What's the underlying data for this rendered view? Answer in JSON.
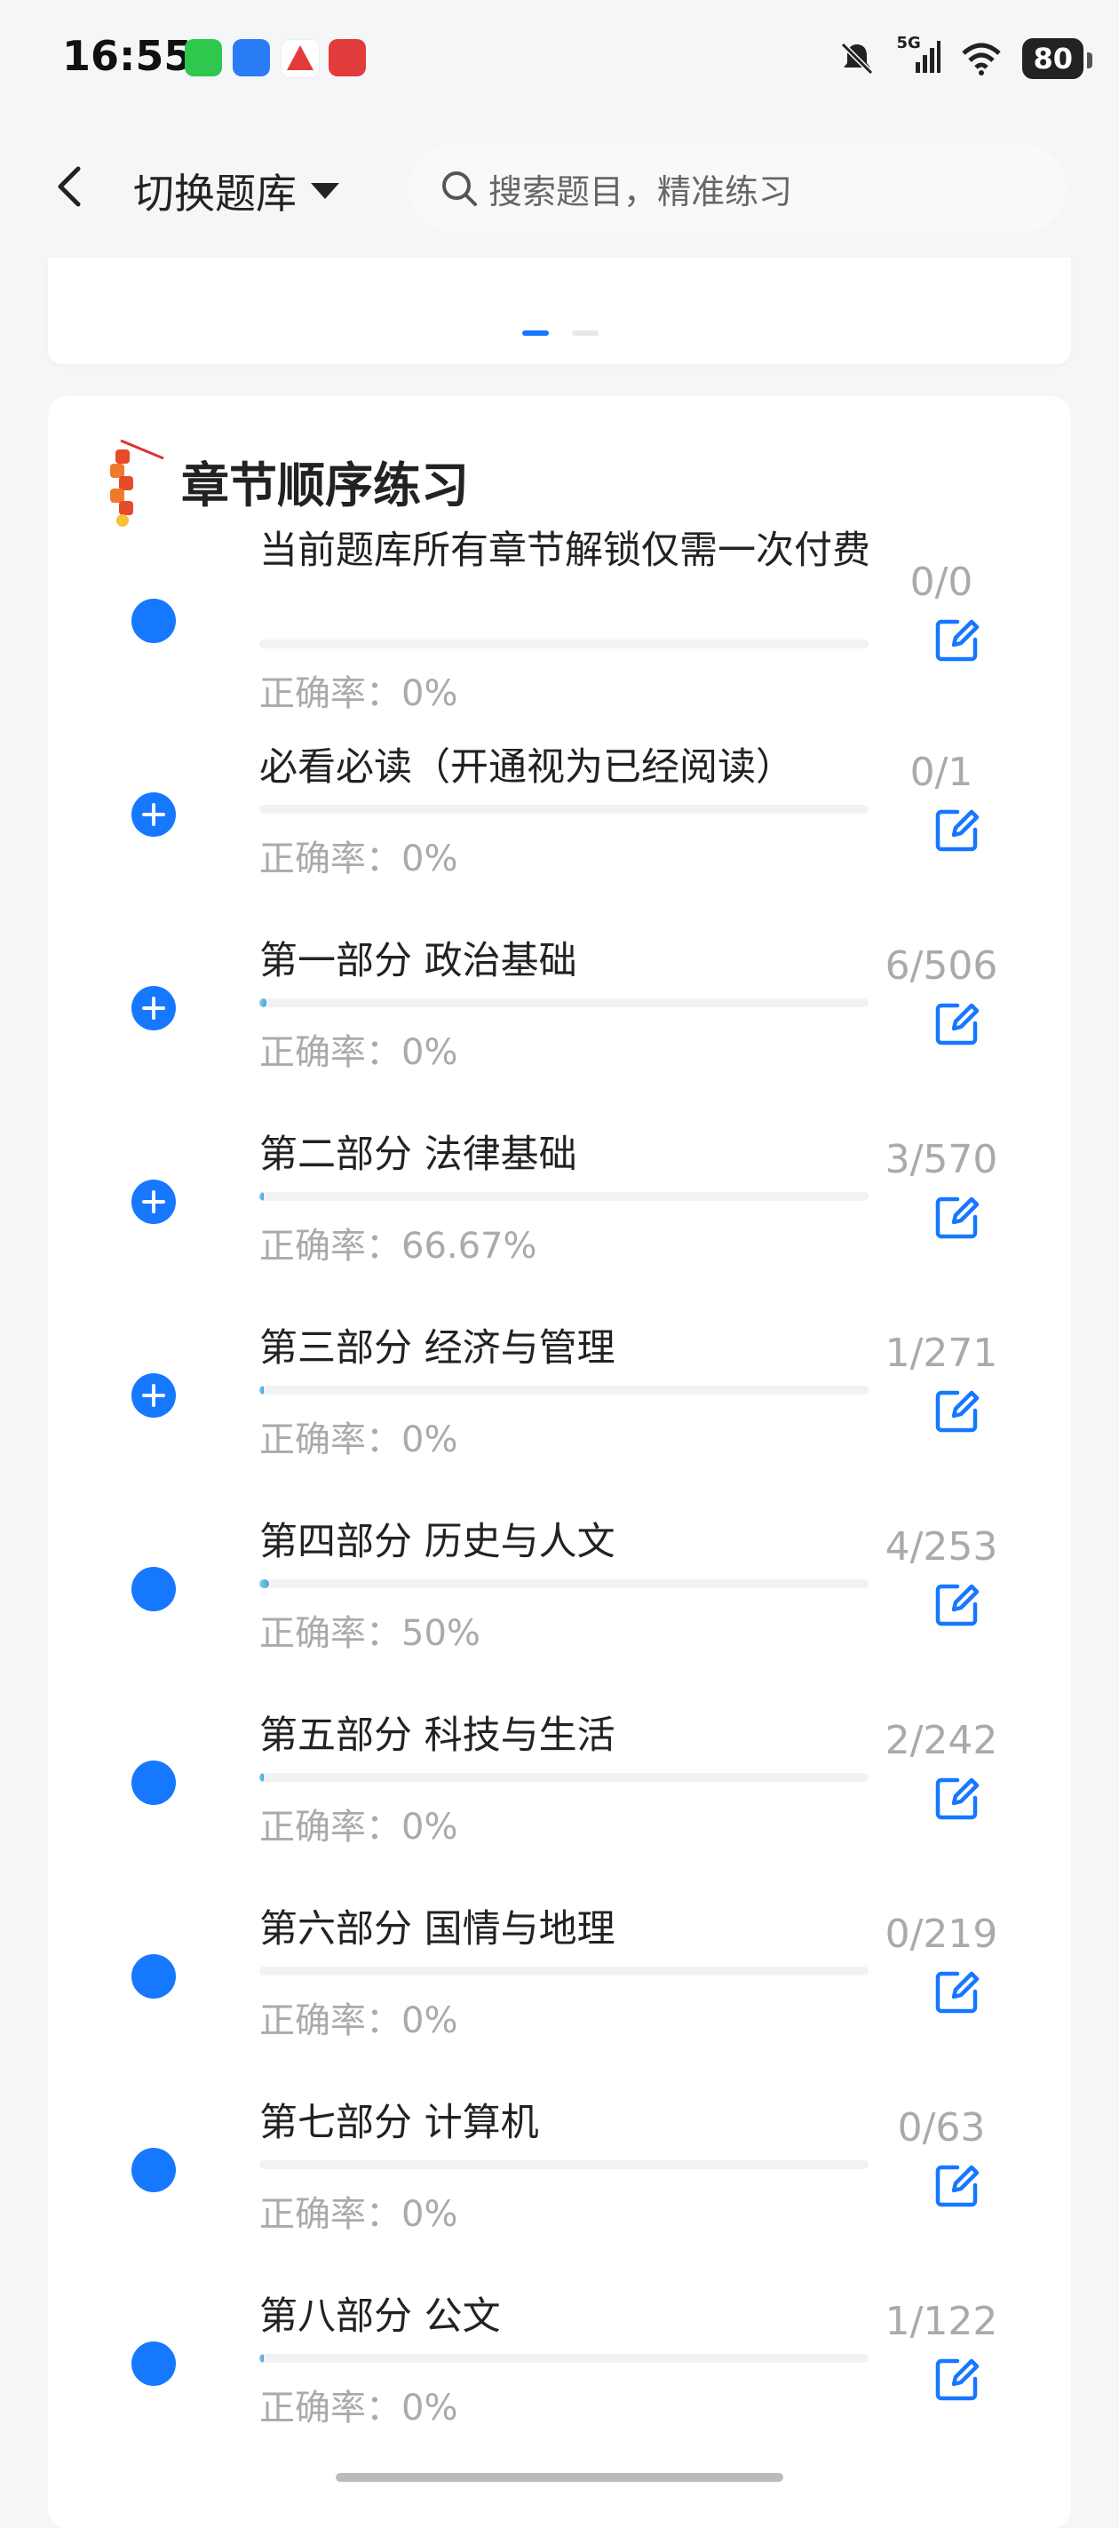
{
  "status": {
    "time": "16:55",
    "network": "5G",
    "battery": "80"
  },
  "header": {
    "switch_label": "切换题库",
    "search_placeholder": "搜索题目，精准练习"
  },
  "section": {
    "title": "章节顺序练习"
  },
  "chapters": [
    {
      "title": "当前题库所有章节解锁仅需一次付费",
      "accuracy": "正确率：0%",
      "count": "0/0",
      "icon": "dot",
      "progress": 0
    },
    {
      "title": "必看必读（开通视为已经阅读）",
      "accuracy": "正确率：0%",
      "count": "0/1",
      "icon": "plus",
      "progress": 0
    },
    {
      "title": "第一部分 政治基础",
      "accuracy": "正确率：0%",
      "count": "6/506",
      "icon": "plus",
      "progress": 0.012
    },
    {
      "title": "第二部分 法律基础",
      "accuracy": "正确率：66.67%",
      "count": "3/570",
      "icon": "plus",
      "progress": 0.005
    },
    {
      "title": "第三部分 经济与管理",
      "accuracy": "正确率：0%",
      "count": "1/271",
      "icon": "plus",
      "progress": 0.004
    },
    {
      "title": "第四部分 历史与人文",
      "accuracy": "正确率：50%",
      "count": "4/253",
      "icon": "dot",
      "progress": 0.016
    },
    {
      "title": "第五部分 科技与生活",
      "accuracy": "正确率：0%",
      "count": "2/242",
      "icon": "dot",
      "progress": 0.008
    },
    {
      "title": "第六部分 国情与地理",
      "accuracy": "正确率：0%",
      "count": "0/219",
      "icon": "dot",
      "progress": 0
    },
    {
      "title": "第七部分 计算机",
      "accuracy": "正确率：0%",
      "count": "0/63",
      "icon": "dot",
      "progress": 0
    },
    {
      "title": "第八部分 公文",
      "accuracy": "正确率：0%",
      "count": "1/122",
      "icon": "dot",
      "progress": 0.008
    }
  ],
  "colors": {
    "accent": "#1677ff",
    "muted_text": "#aaaaaa"
  }
}
